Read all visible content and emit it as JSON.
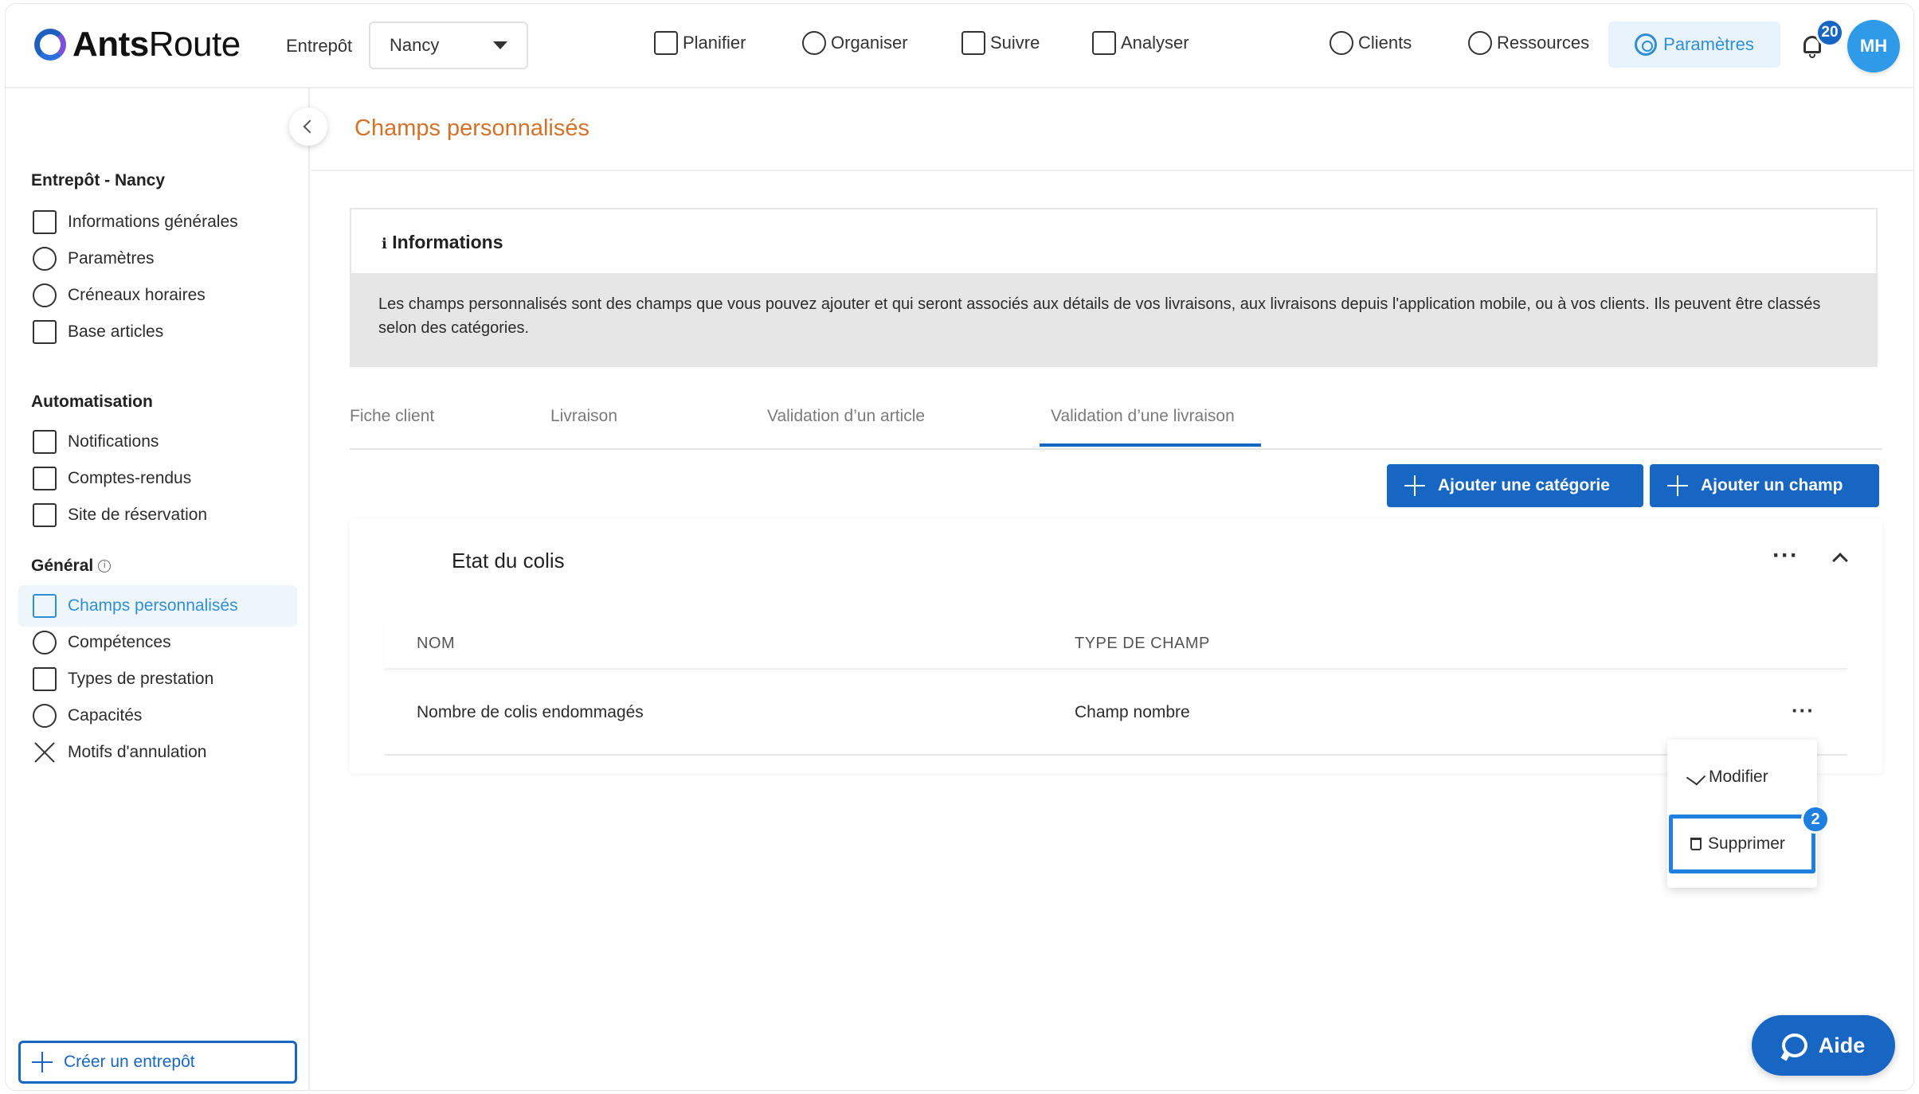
{
  "header": {
    "logo_bold": "Ants",
    "logo_light": "Route",
    "warehouse_label": "Entrepôt",
    "warehouse_value": "Nancy",
    "nav": [
      {
        "label": "Planifier",
        "icon": "calendar-icon"
      },
      {
        "label": "Organiser",
        "icon": "gauge-icon"
      },
      {
        "label": "Suivre",
        "icon": "signpost-icon"
      },
      {
        "label": "Analyser",
        "icon": "chart-icon"
      },
      {
        "label": "Clients",
        "icon": "users-icon"
      },
      {
        "label": "Ressources",
        "icon": "user-gear-icon"
      }
    ],
    "settings_label": "Paramètres",
    "notification_count": "20",
    "avatar_initials": "MH"
  },
  "sidebar": {
    "section_warehouse": "Entrepôt - Nancy",
    "warehouse_items": [
      {
        "label": "Informations générales",
        "icon": "building-icon"
      },
      {
        "label": "Paramètres",
        "icon": "nodes-icon"
      },
      {
        "label": "Créneaux horaires",
        "icon": "clock-icon"
      },
      {
        "label": "Base articles",
        "icon": "boxes-icon"
      }
    ],
    "section_automation": "Automatisation",
    "automation_items": [
      {
        "label": "Notifications",
        "icon": "message-icon"
      },
      {
        "label": "Comptes-rendus",
        "icon": "document-icon"
      },
      {
        "label": "Site de réservation",
        "icon": "calendar-grid-icon"
      }
    ],
    "section_general": "Général",
    "general_items": [
      {
        "label": "Champs personnalisés",
        "icon": "form-fields-icon",
        "active": true
      },
      {
        "label": "Compétences",
        "icon": "graduation-cap-icon"
      },
      {
        "label": "Types de prestation",
        "icon": "service-chart-icon"
      },
      {
        "label": "Capacités",
        "icon": "scale-icon"
      },
      {
        "label": "Motifs d'annulation",
        "icon": "cross-icon"
      }
    ],
    "create_label": "Créer un entrepôt"
  },
  "main": {
    "page_title": "Champs personnalisés",
    "info": {
      "title": "Informations",
      "body": "Les champs personnalisés sont des champs que vous pouvez ajouter et qui seront associés aux détails de vos livraisons, aux livraisons depuis l'application mobile, ou à vos clients. Ils peuvent être classés selon des catégories."
    },
    "tabs": [
      "Fiche client",
      "Livraison",
      "Validation d’un article",
      "Validation d’une livraison"
    ],
    "active_tab": "Validation d’une livraison",
    "buttons": {
      "add_category": "Ajouter une catégorie",
      "add_field": "Ajouter un champ"
    },
    "category": {
      "title": "Etat du colis",
      "columns": [
        "NOM",
        "TYPE DE CHAMP"
      ],
      "rows": [
        {
          "name": "Nombre de colis endommagés",
          "type": "Champ nombre"
        }
      ]
    },
    "row_menu": {
      "edit": "Modifier",
      "delete": "Supprimer",
      "step_badge": "2"
    }
  },
  "help": {
    "label": "Aide"
  },
  "colors": {
    "primary": "#1866c4",
    "accent_light": "#2f8fd6",
    "title_orange": "#d4722a",
    "highlight": "#1e7fe0"
  }
}
